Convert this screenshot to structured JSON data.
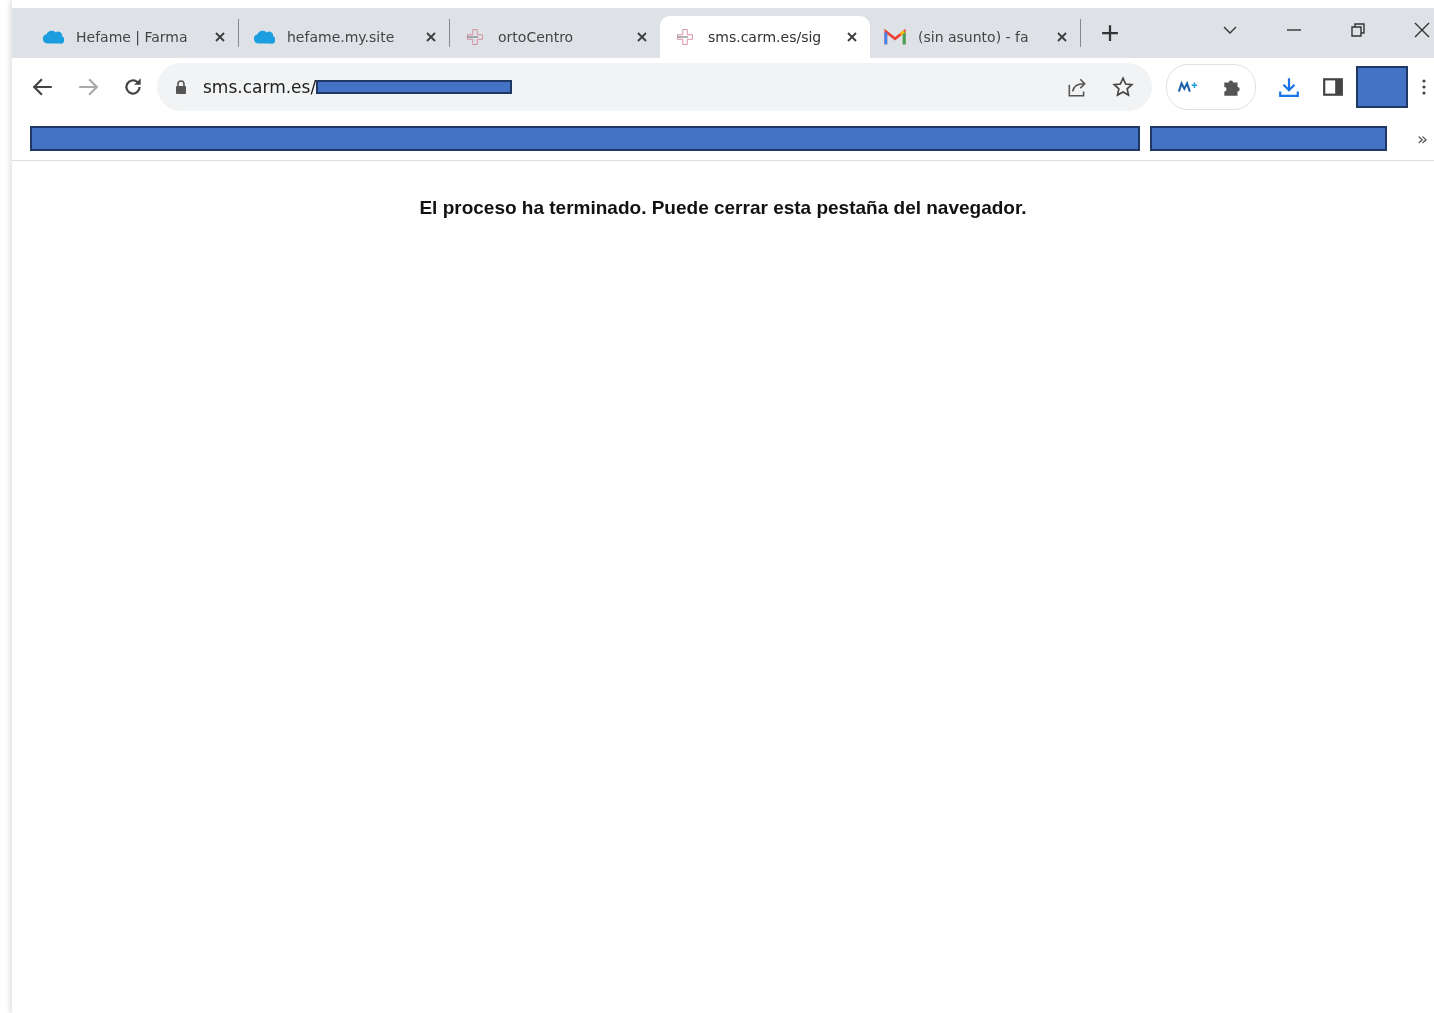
{
  "tabs": [
    {
      "title": "Hefame | Farma",
      "kind": "cloud",
      "selected": false
    },
    {
      "title": "hefame.my.site",
      "kind": "cloud",
      "selected": false
    },
    {
      "title": "ortoCentro",
      "kind": "cross",
      "selected": false
    },
    {
      "title": "sms.carm.es/sig",
      "kind": "cross",
      "selected": true
    },
    {
      "title": "(sin asunto) - fa",
      "kind": "mail",
      "selected": false
    }
  ],
  "address_bar": {
    "url": "sms.carm.es/"
  },
  "bookmarks_bar": {
    "overflow": "»"
  },
  "page": {
    "message": "El proceso ha terminado. Puede cerrar esta pestaña del navegador."
  }
}
